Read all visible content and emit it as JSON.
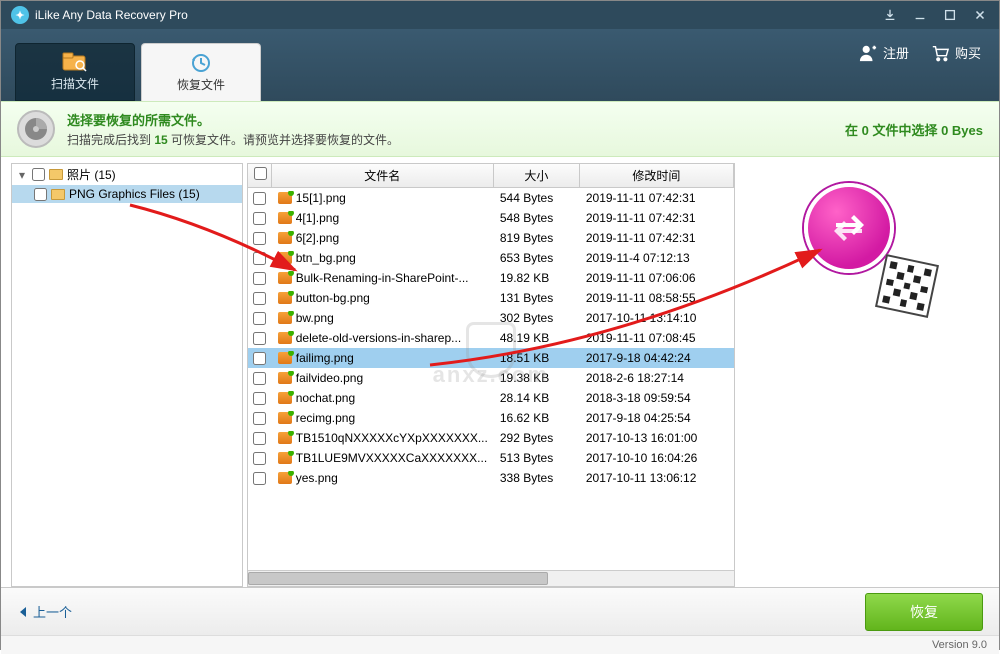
{
  "window": {
    "title": "iLike Any Data Recovery Pro",
    "version_label": "Version 9.0"
  },
  "header": {
    "tab_scan": "扫描文件",
    "tab_recover": "恢复文件",
    "register": "注册",
    "buy": "购买"
  },
  "infobar": {
    "line1": "选择要恢复的所需文件。",
    "line2_prefix": "扫描完成后找到 ",
    "line2_count": "15",
    "line2_suffix": " 可恢复文件。请预览并选择要恢复的文件。",
    "selected_prefix": "在 ",
    "selected_count": "0",
    "selected_mid": " 文件中选择 ",
    "selected_size": "0 Byes"
  },
  "tree": {
    "root": "照片 (15)",
    "child": "PNG Graphics Files (15)"
  },
  "columns": {
    "name": "文件名",
    "size": "大小",
    "date": "修改时间"
  },
  "files": [
    {
      "name": "15[1].png",
      "size": "544 Bytes",
      "date": "2019-11-11 07:42:31"
    },
    {
      "name": "4[1].png",
      "size": "548 Bytes",
      "date": "2019-11-11 07:42:31"
    },
    {
      "name": "6[2].png",
      "size": "819 Bytes",
      "date": "2019-11-11 07:42:31"
    },
    {
      "name": "btn_bg.png",
      "size": "653 Bytes",
      "date": "2019-11-4 07:12:13"
    },
    {
      "name": "Bulk-Renaming-in-SharePoint-...",
      "size": "19.82 KB",
      "date": "2019-11-11 07:06:06"
    },
    {
      "name": "button-bg.png",
      "size": "131 Bytes",
      "date": "2019-11-11 08:58:55"
    },
    {
      "name": "bw.png",
      "size": "302 Bytes",
      "date": "2017-10-11 13:14:10"
    },
    {
      "name": "delete-old-versions-in-sharep...",
      "size": "48.19 KB",
      "date": "2019-11-11 07:08:45"
    },
    {
      "name": "failimg.png",
      "size": "18.51 KB",
      "date": "2017-9-18 04:42:24"
    },
    {
      "name": "failvideo.png",
      "size": "19.38 KB",
      "date": "2018-2-6 18:27:14"
    },
    {
      "name": "nochat.png",
      "size": "28.14 KB",
      "date": "2018-3-18 09:59:54"
    },
    {
      "name": "recimg.png",
      "size": "16.62 KB",
      "date": "2017-9-18 04:25:54"
    },
    {
      "name": "TB1510qNXXXXXcYXpXXXXXXX...",
      "size": "292 Bytes",
      "date": "2017-10-13 16:01:00"
    },
    {
      "name": "TB1LUE9MVXXXXXCaXXXXXXX...",
      "size": "513 Bytes",
      "date": "2017-10-10 16:04:26"
    },
    {
      "name": "yes.png",
      "size": "338 Bytes",
      "date": "2017-10-11 13:06:12"
    }
  ],
  "selected_index": 8,
  "footer": {
    "back": "上一个",
    "recover": "恢复"
  },
  "watermark": "anxz.com"
}
